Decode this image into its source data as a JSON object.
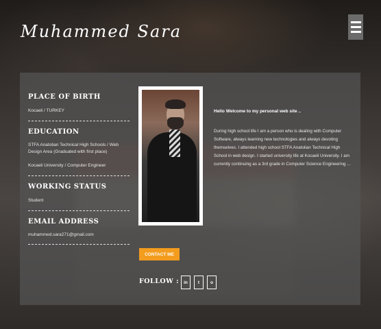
{
  "header": {
    "title": "Muhammed Sara"
  },
  "sections": {
    "birth": {
      "heading": "PLACE OF BIRTH",
      "text": "Kocaeli / TURKEY"
    },
    "education": {
      "heading": "EDUCATION",
      "item1": "STFA Anatolian Technical High Schools / Web Design Area (Graduated with first place)",
      "item2": "Kocaeli University / Computer Engineer"
    },
    "working": {
      "heading": "WORKING STATUS",
      "text": "Student"
    },
    "email": {
      "heading": "EMAIL ADDRESS",
      "text": "muhammed.sara271@gmail.com"
    }
  },
  "about": {
    "welcome": "Hello Welcome to my personal web site ..",
    "text": "During high school life I am a person who is dealing with Computer Software, always learning new technologies and always devoting themselves. I attended high school STFA Anatolian Technical High School in web design. I started university life at Kocaeli University. I am currently continuing as a 3rd grade in Computer Science Engineering ..."
  },
  "actions": {
    "contact_label": "CONTACT ME",
    "follow_label": "FOLLOW :"
  },
  "social": [
    {
      "icon": "linkedin-icon",
      "glyph": "in"
    },
    {
      "icon": "twitter-icon",
      "glyph": "t"
    },
    {
      "icon": "instagram-icon",
      "glyph": "o"
    }
  ],
  "colors": {
    "accent": "#f39c1e",
    "card": "#555555",
    "text": "#ffffff"
  }
}
